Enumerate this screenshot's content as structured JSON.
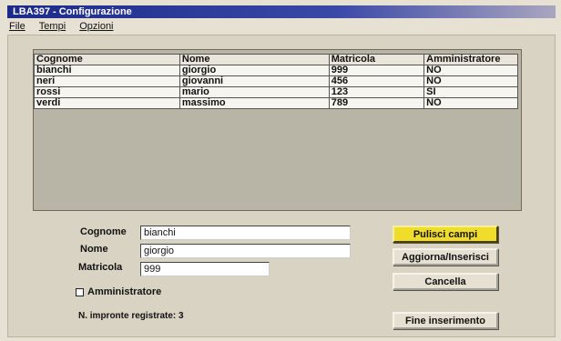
{
  "window": {
    "title": "LBA397 - Configurazione"
  },
  "menu": {
    "items": [
      "File",
      "Tempi",
      "Opzioni"
    ]
  },
  "grid": {
    "headers": [
      "Cognome",
      "Nome",
      "Matricola",
      "Amministratore"
    ],
    "rows": [
      [
        "bianchi",
        "giorgio",
        "999",
        "NO"
      ],
      [
        "neri",
        "giovanni",
        "456",
        "NO"
      ],
      [
        "rossi",
        "mario",
        "123",
        "SI"
      ],
      [
        "verdi",
        "massimo",
        "789",
        "NO"
      ]
    ]
  },
  "form": {
    "cognome_label": "Cognome",
    "cognome_value": "bianchi",
    "nome_label": "Nome",
    "nome_value": "giorgio",
    "matricola_label": "Matricola",
    "matricola_value": "999",
    "admin_label": "Amministratore",
    "admin_checked": false,
    "impronte_label": "N. impronte registrate: 3"
  },
  "buttons": {
    "pulisci": "Pulisci campi",
    "aggiorna": "Aggiorna/Inserisci",
    "cancella": "Cancella",
    "fine": "Fine inserimento"
  },
  "colors": {
    "titlebar": "#1c2a8a",
    "highlight_button": "#f0dc2a",
    "background": "#e7e1d3"
  }
}
